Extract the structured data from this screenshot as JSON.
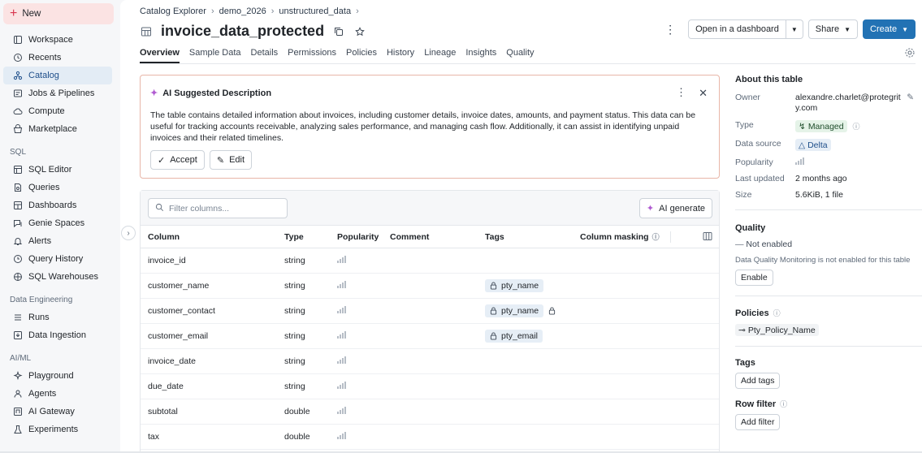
{
  "sidebar": {
    "new_label": "New",
    "items": [
      {
        "label": "Workspace",
        "icon": "workspace-icon"
      },
      {
        "label": "Recents",
        "icon": "clock-icon"
      },
      {
        "label": "Catalog",
        "icon": "catalog-icon",
        "active": true
      },
      {
        "label": "Jobs & Pipelines",
        "icon": "jobs-icon"
      },
      {
        "label": "Compute",
        "icon": "cloud-icon"
      },
      {
        "label": "Marketplace",
        "icon": "marketplace-icon"
      }
    ],
    "sql_section": "SQL",
    "sql_items": [
      {
        "label": "SQL Editor",
        "icon": "editor-icon"
      },
      {
        "label": "Queries",
        "icon": "queries-icon"
      },
      {
        "label": "Dashboards",
        "icon": "dashboard-icon"
      },
      {
        "label": "Genie Spaces",
        "icon": "genie-icon"
      },
      {
        "label": "Alerts",
        "icon": "bell-icon"
      },
      {
        "label": "Query History",
        "icon": "history-icon"
      },
      {
        "label": "SQL Warehouses",
        "icon": "warehouse-icon"
      }
    ],
    "de_section": "Data Engineering",
    "de_items": [
      {
        "label": "Runs",
        "icon": "runs-icon"
      },
      {
        "label": "Data Ingestion",
        "icon": "ingestion-icon"
      }
    ],
    "ai_section": "AI/ML",
    "ai_items": [
      {
        "label": "Playground",
        "icon": "playground-icon"
      },
      {
        "label": "Agents",
        "icon": "agents-icon"
      },
      {
        "label": "AI Gateway",
        "icon": "gateway-icon"
      },
      {
        "label": "Experiments",
        "icon": "experiments-icon"
      }
    ]
  },
  "breadcrumb": [
    "Catalog Explorer",
    "demo_2026",
    "unstructured_data"
  ],
  "title": "invoice_data_protected",
  "actions": {
    "open_dashboard": "Open in a dashboard",
    "share": "Share",
    "create": "Create"
  },
  "tabs": [
    "Overview",
    "Sample Data",
    "Details",
    "Permissions",
    "Policies",
    "History",
    "Lineage",
    "Insights",
    "Quality"
  ],
  "ai_card": {
    "title": "AI Suggested Description",
    "text": "The table contains detailed information about invoices, including customer details, invoice dates, amounts, and payment status. This data can be useful for tracking accounts receivable, analyzing sales performance, and managing cash flow. Additionally, it can assist in identifying unpaid invoices and their related timelines.",
    "accept": "Accept",
    "edit": "Edit"
  },
  "columns_table": {
    "filter_placeholder": "Filter columns...",
    "ai_generate": "AI generate",
    "headers": [
      "Column",
      "Type",
      "Popularity",
      "Comment",
      "Tags",
      "Column masking"
    ],
    "rows": [
      {
        "column": "invoice_id",
        "type": "string",
        "tag": "",
        "masked": false
      },
      {
        "column": "customer_name",
        "type": "string",
        "tag": "pty_name",
        "masked": false
      },
      {
        "column": "customer_contact",
        "type": "string",
        "tag": "pty_name",
        "masked": true
      },
      {
        "column": "customer_email",
        "type": "string",
        "tag": "pty_email",
        "masked": false
      },
      {
        "column": "invoice_date",
        "type": "string",
        "tag": "",
        "masked": false
      },
      {
        "column": "due_date",
        "type": "string",
        "tag": "",
        "masked": false
      },
      {
        "column": "subtotal",
        "type": "double",
        "tag": "",
        "masked": false
      },
      {
        "column": "tax",
        "type": "double",
        "tag": "",
        "masked": false
      }
    ]
  },
  "about": {
    "title": "About this table",
    "owner_label": "Owner",
    "owner_value": "alexandre.charlet@protegrity.com",
    "type_label": "Type",
    "type_value": "Managed",
    "source_label": "Data source",
    "source_value": "Delta",
    "popularity_label": "Popularity",
    "updated_label": "Last updated",
    "updated_value": "2 months ago",
    "size_label": "Size",
    "size_value": "5.6KiB, 1 file"
  },
  "quality": {
    "title": "Quality",
    "status": "Not enabled",
    "note": "Data Quality Monitoring is not enabled for this table",
    "enable": "Enable"
  },
  "policies": {
    "title": "Policies",
    "item": "Pty_Policy_Name"
  },
  "tags": {
    "title": "Tags",
    "add": "Add tags"
  },
  "row_filter": {
    "title": "Row filter",
    "add": "Add filter"
  },
  "colors": {
    "accent": "#2272b4",
    "active_nav": "#e3ecf5",
    "new_button": "#fbe3e3",
    "ai_border": "#e8b6a8"
  }
}
